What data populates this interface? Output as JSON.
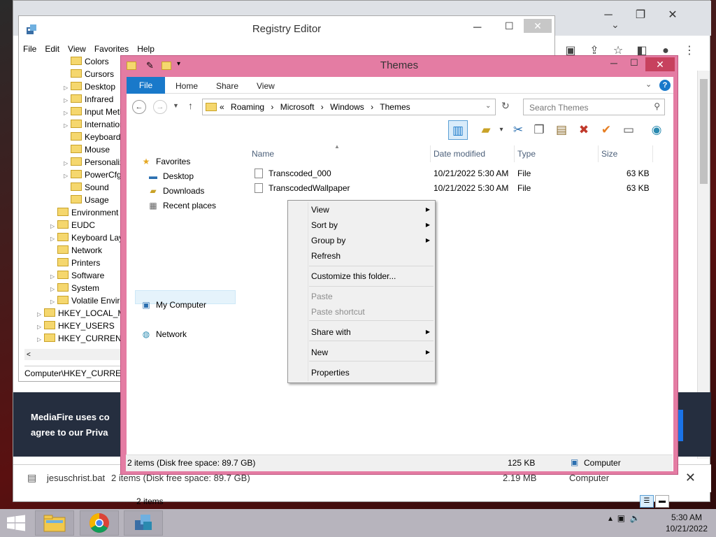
{
  "chrome": {
    "min_glyph": "─",
    "max_glyph": "❐",
    "close_glyph": "✕",
    "expand_glyph": "⌄",
    "mf_banner_line1": "MediaFire uses co",
    "mf_banner_line2": "agree to our Priva",
    "download_name": "jesuschrist.bat",
    "download_bg_items": "2 items (Disk free space: 89.7 GB)",
    "download_bg_size": "2.19 MB",
    "download_bg_computer": "Computer",
    "close_glyph2": "✕"
  },
  "registry": {
    "title": "Registry Editor",
    "menu": [
      "File",
      "Edit",
      "View",
      "Favorites",
      "Help"
    ],
    "tree": [
      {
        "label": "Colors",
        "depth": 2,
        "arrow": ""
      },
      {
        "label": "Cursors",
        "depth": 2,
        "arrow": ""
      },
      {
        "label": "Desktop",
        "depth": 2,
        "arrow": "▷"
      },
      {
        "label": "Infrared",
        "depth": 2,
        "arrow": "▷"
      },
      {
        "label": "Input Method",
        "depth": 2,
        "arrow": "▷"
      },
      {
        "label": "International",
        "depth": 2,
        "arrow": "▷"
      },
      {
        "label": "Keyboard",
        "depth": 2,
        "arrow": ""
      },
      {
        "label": "Mouse",
        "depth": 2,
        "arrow": ""
      },
      {
        "label": "Personalization",
        "depth": 2,
        "arrow": "▷"
      },
      {
        "label": "PowerCfg",
        "depth": 2,
        "arrow": "▷"
      },
      {
        "label": "Sound",
        "depth": 2,
        "arrow": ""
      },
      {
        "label": "Usage",
        "depth": 2,
        "arrow": ""
      },
      {
        "label": "Environment",
        "depth": 1,
        "arrow": ""
      },
      {
        "label": "EUDC",
        "depth": 1,
        "arrow": "▷"
      },
      {
        "label": "Keyboard Layout",
        "depth": 1,
        "arrow": "▷"
      },
      {
        "label": "Network",
        "depth": 1,
        "arrow": ""
      },
      {
        "label": "Printers",
        "depth": 1,
        "arrow": ""
      },
      {
        "label": "Software",
        "depth": 1,
        "arrow": "▷"
      },
      {
        "label": "System",
        "depth": 1,
        "arrow": "▷"
      },
      {
        "label": "Volatile Environment",
        "depth": 1,
        "arrow": "▷"
      },
      {
        "label": "HKEY_LOCAL_MACHINE",
        "depth": 0,
        "arrow": "▷"
      },
      {
        "label": "HKEY_USERS",
        "depth": 0,
        "arrow": "▷"
      },
      {
        "label": "HKEY_CURRENT_CONFIG",
        "depth": 0,
        "arrow": "▷"
      }
    ],
    "status": "Computer\\HKEY_CURRENT_USER",
    "hscroll_left": "<"
  },
  "explorer": {
    "title": "Themes",
    "tabs": {
      "file": "File",
      "home": "Home",
      "share": "Share",
      "view": "View"
    },
    "help": "?",
    "breadcrumb": [
      "«",
      "Roaming",
      "›",
      "Microsoft",
      "›",
      "Windows",
      "›",
      "Themes"
    ],
    "search_placeholder": "Search Themes",
    "nav": {
      "favorites": "Favorites",
      "desktop": "Desktop",
      "downloads": "Downloads",
      "recent": "Recent places",
      "mycomputer": "My Computer",
      "network": "Network"
    },
    "columns": {
      "name": "Name",
      "date": "Date modified",
      "type": "Type",
      "size": "Size"
    },
    "files": [
      {
        "name": "Transcoded_000",
        "date": "10/21/2022 5:30 AM",
        "type": "File",
        "size": "63 KB"
      },
      {
        "name": "TranscodedWallpaper",
        "date": "10/21/2022 5:30 AM",
        "type": "File",
        "size": "63 KB"
      }
    ],
    "items_count": "2 items",
    "status_items": "2 items (Disk free space: 89.7 GB)",
    "status_size": "125 KB",
    "status_location": "Computer",
    "accent": "#1979ca",
    "frame_color": "#e47ca3"
  },
  "context_menu": {
    "items": [
      {
        "label": "View",
        "sub": true,
        "disabled": false
      },
      {
        "label": "Sort by",
        "sub": true,
        "disabled": false
      },
      {
        "label": "Group by",
        "sub": true,
        "disabled": false
      },
      {
        "label": "Refresh",
        "sub": false,
        "disabled": false
      },
      {
        "label": "Customize this folder...",
        "sub": false,
        "disabled": false
      },
      {
        "label": "Paste",
        "sub": false,
        "disabled": true
      },
      {
        "label": "Paste shortcut",
        "sub": false,
        "disabled": true
      },
      {
        "label": "Share with",
        "sub": true,
        "disabled": false
      },
      {
        "label": "New",
        "sub": true,
        "disabled": false
      },
      {
        "label": "Properties",
        "sub": false,
        "disabled": false
      }
    ]
  },
  "taskbar": {
    "time": "5:30 AM",
    "date": "10/21/2022",
    "apps": [
      "file-explorer-icon",
      "chrome-icon",
      "registry-editor-icon"
    ]
  }
}
